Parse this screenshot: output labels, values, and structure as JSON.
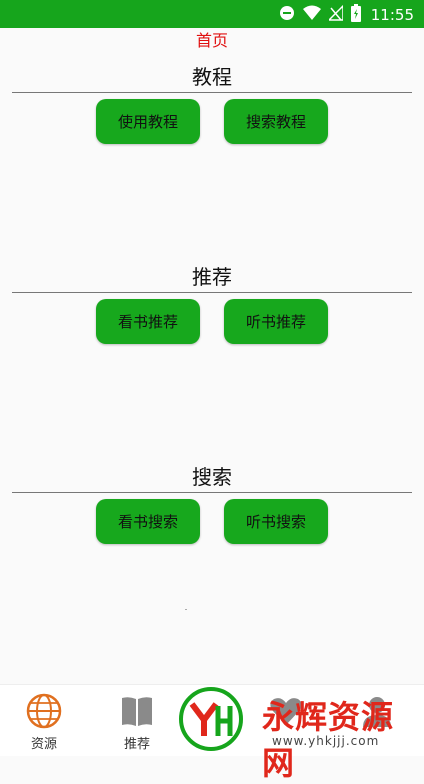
{
  "status": {
    "time": "11:55"
  },
  "page": {
    "title": "首页"
  },
  "sections": [
    {
      "heading": "教程",
      "buttons": [
        "使用教程",
        "搜索教程"
      ]
    },
    {
      "heading": "推荐",
      "buttons": [
        "看书推荐",
        "听书推荐"
      ]
    },
    {
      "heading": "搜索",
      "buttons": [
        "看书搜索",
        "听书搜索"
      ]
    }
  ],
  "tabs": [
    {
      "label": "资源",
      "icon": "globe-icon"
    },
    {
      "label": "推荐",
      "icon": "book-icon"
    },
    {
      "label": "",
      "icon": "heart-icon"
    },
    {
      "label": "",
      "icon": "user-icon"
    }
  ],
  "watermark": {
    "brand": "永辉资源网",
    "url": "www.yhkjjj.com",
    "logo_text": "YH"
  },
  "colors": {
    "accent": "#16a51c",
    "title_red": "#e01010",
    "tab_icon_orange": "#e07020"
  }
}
